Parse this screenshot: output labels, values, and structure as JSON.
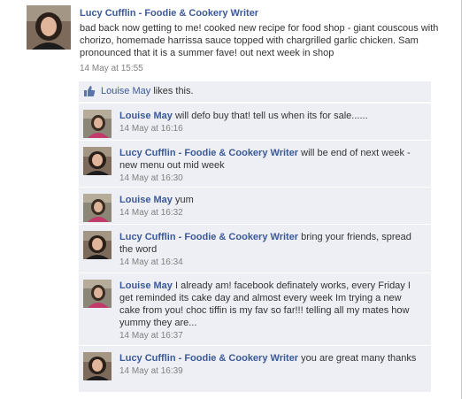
{
  "post": {
    "author": "Lucy Cufflin - Foodie & Cookery Writer",
    "text": "bad back now getting to me! cooked new recipe for food shop - giant couscous with chorizo, homemade harrissa sauce topped with chargrilled garlic chicken. Sam pronounced that it is a summer fave! out next week in shop",
    "timestamp": "14 May at 15:55"
  },
  "likes": {
    "liker": "Louise May",
    "suffix": " likes this."
  },
  "comments": [
    {
      "author": "Louise May",
      "text": " will defo buy that! tell us when its for sale......",
      "timestamp": "14 May at 16:16"
    },
    {
      "author": "Lucy Cufflin - Foodie & Cookery Writer",
      "text": " will be end of next week - new menu out mid week",
      "timestamp": "14 May at 16:30"
    },
    {
      "author": "Louise May",
      "text": " yum",
      "timestamp": "14 May at 16:32"
    },
    {
      "author": "Lucy Cufflin - Foodie & Cookery Writer",
      "text": " bring your friends, spread the word",
      "timestamp": "14 May at 16:34"
    },
    {
      "author": "Louise May",
      "text": " I already am! facebook definately works, every Friday I get reminded its cake day and almost every week Im trying a new cake from you! choc tiffin is my fav so far!!! telling all my mates how yummy they are...",
      "timestamp": "14 May at 16:37"
    },
    {
      "author": "Lucy Cufflin - Foodie & Cookery Writer",
      "text": " you are great many thanks",
      "timestamp": "14 May at 16:39"
    }
  ],
  "colors": {
    "link": "#3b5998",
    "comment_bg": "#edeff4",
    "timestamp": "#808080"
  }
}
